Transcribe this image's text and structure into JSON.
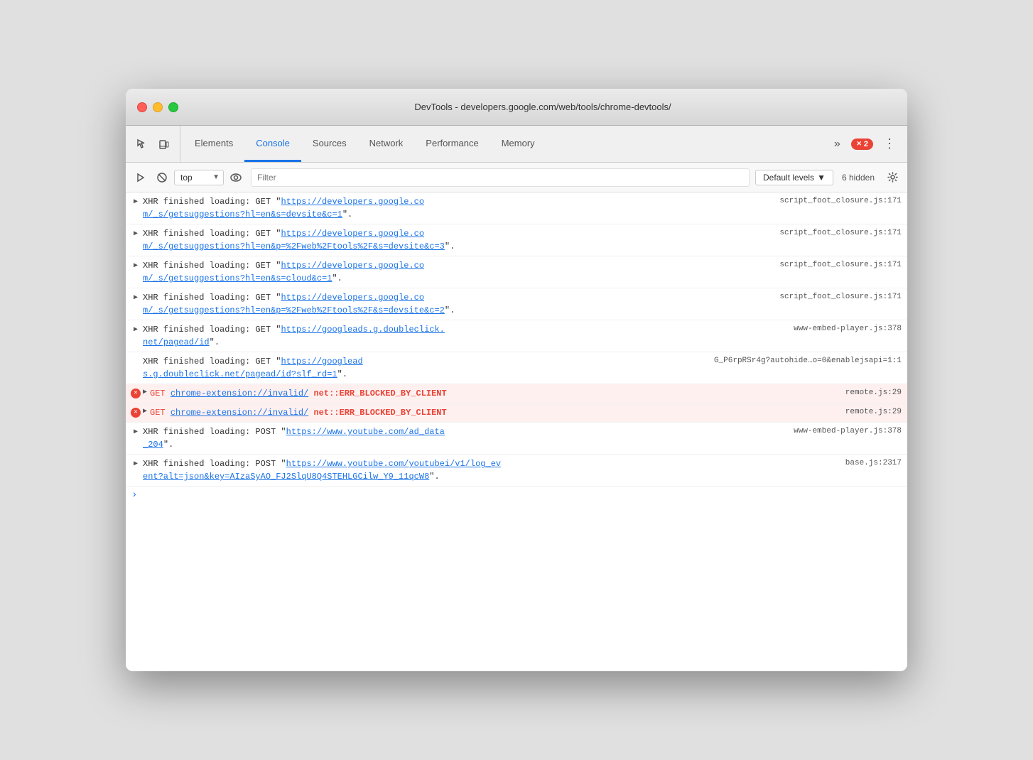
{
  "window": {
    "title": "DevTools - developers.google.com/web/tools/chrome-devtools/"
  },
  "traffic_lights": {
    "close": "close",
    "minimize": "minimize",
    "maximize": "maximize"
  },
  "tabs": [
    {
      "id": "elements",
      "label": "Elements",
      "active": false
    },
    {
      "id": "console",
      "label": "Console",
      "active": true
    },
    {
      "id": "sources",
      "label": "Sources",
      "active": false
    },
    {
      "id": "network",
      "label": "Network",
      "active": false
    },
    {
      "id": "performance",
      "label": "Performance",
      "active": false
    },
    {
      "id": "memory",
      "label": "Memory",
      "active": false
    }
  ],
  "toolbar": {
    "more_label": "»",
    "error_count": "2",
    "dots_label": "⋮",
    "run_label": "▶",
    "clear_label": "🚫",
    "context_value": "top",
    "eye_label": "👁",
    "filter_placeholder": "Filter",
    "levels_label": "Default levels",
    "hidden_label": "6 hidden",
    "settings_label": "⚙"
  },
  "console_entries": [
    {
      "id": 1,
      "type": "xhr",
      "has_arrow": true,
      "is_error": false,
      "content_line1": "XHR finished loading: GET \"https://developers.google.co",
      "content_line2": "m/_s/getsuggestions?hl=en&s=devsite&c=1\".",
      "source": "script_foot_closure.js:171"
    },
    {
      "id": 2,
      "type": "xhr",
      "has_arrow": true,
      "is_error": false,
      "content_line1": "XHR finished loading: GET \"https://developers.google.co",
      "content_line2": "m/_s/getsuggestions?hl=en&p=%2Fweb%2Ftools%2F&s=devsite&c=3\".",
      "source": "script_foot_closure.js:171"
    },
    {
      "id": 3,
      "type": "xhr",
      "has_arrow": true,
      "is_error": false,
      "content_line1": "XHR finished loading: GET \"https://developers.google.co",
      "content_line2": "m/_s/getsuggestions?hl=en&s=cloud&c=1\".",
      "source": "script_foot_closure.js:171"
    },
    {
      "id": 4,
      "type": "xhr",
      "has_arrow": true,
      "is_error": false,
      "content_line1": "XHR finished loading: GET \"https://developers.google.co",
      "content_line2": "m/_s/getsuggestions?hl=en&p=%2Fweb%2Ftools%2F&s=devsite&c=2\".",
      "source": "script_foot_closure.js:171"
    },
    {
      "id": 5,
      "type": "xhr",
      "has_arrow": true,
      "is_error": false,
      "content_line1": "XHR finished loading: GET \"https://googleads.g.doubleclick.",
      "content_line2": "net/pagead/id\".",
      "source": "www-embed-player.js:378"
    },
    {
      "id": 6,
      "type": "xhr",
      "has_arrow": false,
      "is_error": false,
      "content_line1": "XHR finished loading: GET \"https://googlead",
      "content_line2": "s.g.doubleclick.net/pagead/id?slf_rd=1\".",
      "source": "G_P6rpRSr4g?autohide…o=0&enablejsapi=1:1"
    },
    {
      "id": 7,
      "type": "error",
      "has_arrow": true,
      "is_error": true,
      "content_line1": "GET chrome-extension://invalid/  net::ERR_BLOCKED_BY_CLIENT",
      "source": "remote.js:29"
    },
    {
      "id": 8,
      "type": "error",
      "has_arrow": true,
      "is_error": true,
      "content_line1": "GET chrome-extension://invalid/  net::ERR_BLOCKED_BY_CLIENT",
      "source": "remote.js:29"
    },
    {
      "id": 9,
      "type": "xhr",
      "has_arrow": true,
      "is_error": false,
      "content_line1": "XHR finished loading: POST \"https://www.youtube.com/ad_data",
      "content_line2": "_204\".",
      "source": "www-embed-player.js:378"
    },
    {
      "id": 10,
      "type": "xhr",
      "has_arrow": true,
      "is_error": false,
      "content_line1": "XHR finished loading: POST \"https://www.youtube.com/youtubei/v1/log_ev",
      "content_line2": "ent?alt=json&key=AIzaSyAO_FJ2SlqU8Q4STEHLGCilw_Y9_11qcW8\".",
      "source": "base.js:2317"
    }
  ]
}
